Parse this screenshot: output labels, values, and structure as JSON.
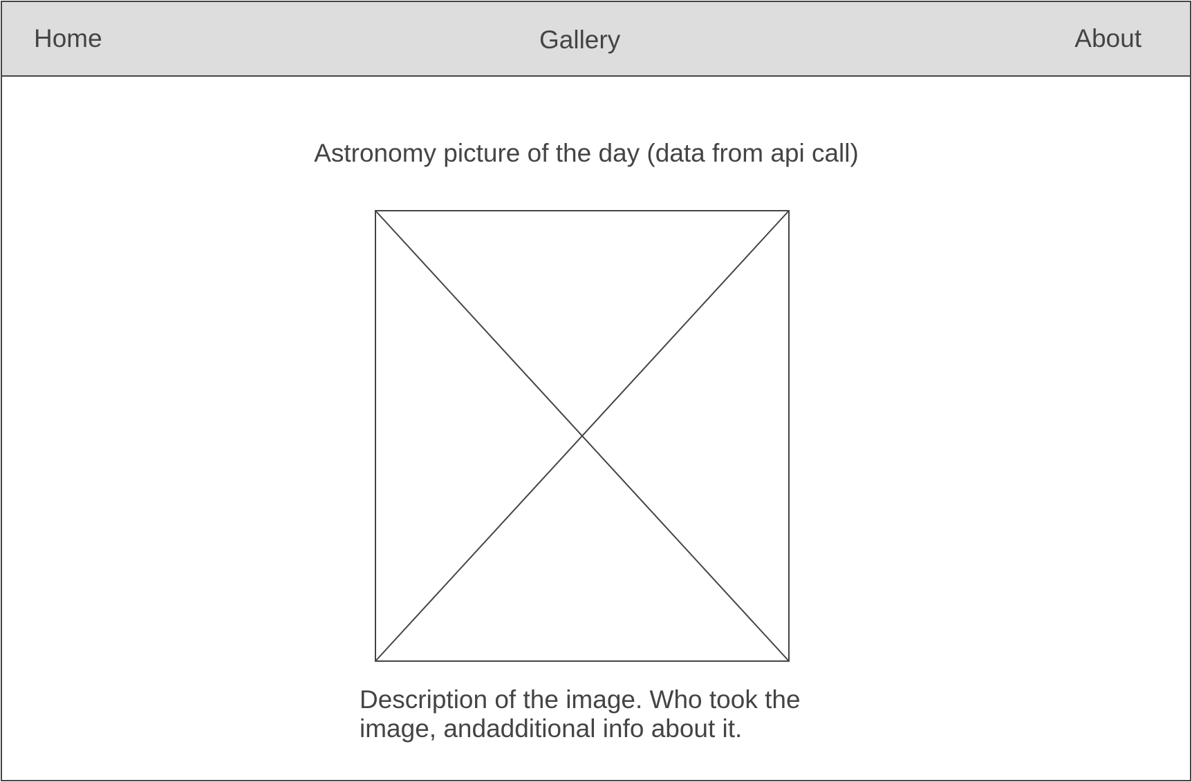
{
  "nav": {
    "home_label": "Home",
    "gallery_label": "Gallery",
    "about_label": "About"
  },
  "main": {
    "title": "Astronomy picture of the day (data from api call)",
    "image_icon": "image-placeholder-icon",
    "description": "Description of the image. Who took the image, andadditional info about it."
  },
  "colors": {
    "navbar_background": "#dddddd",
    "text": "#444444",
    "border": "#444444",
    "page_background": "#ffffff"
  }
}
